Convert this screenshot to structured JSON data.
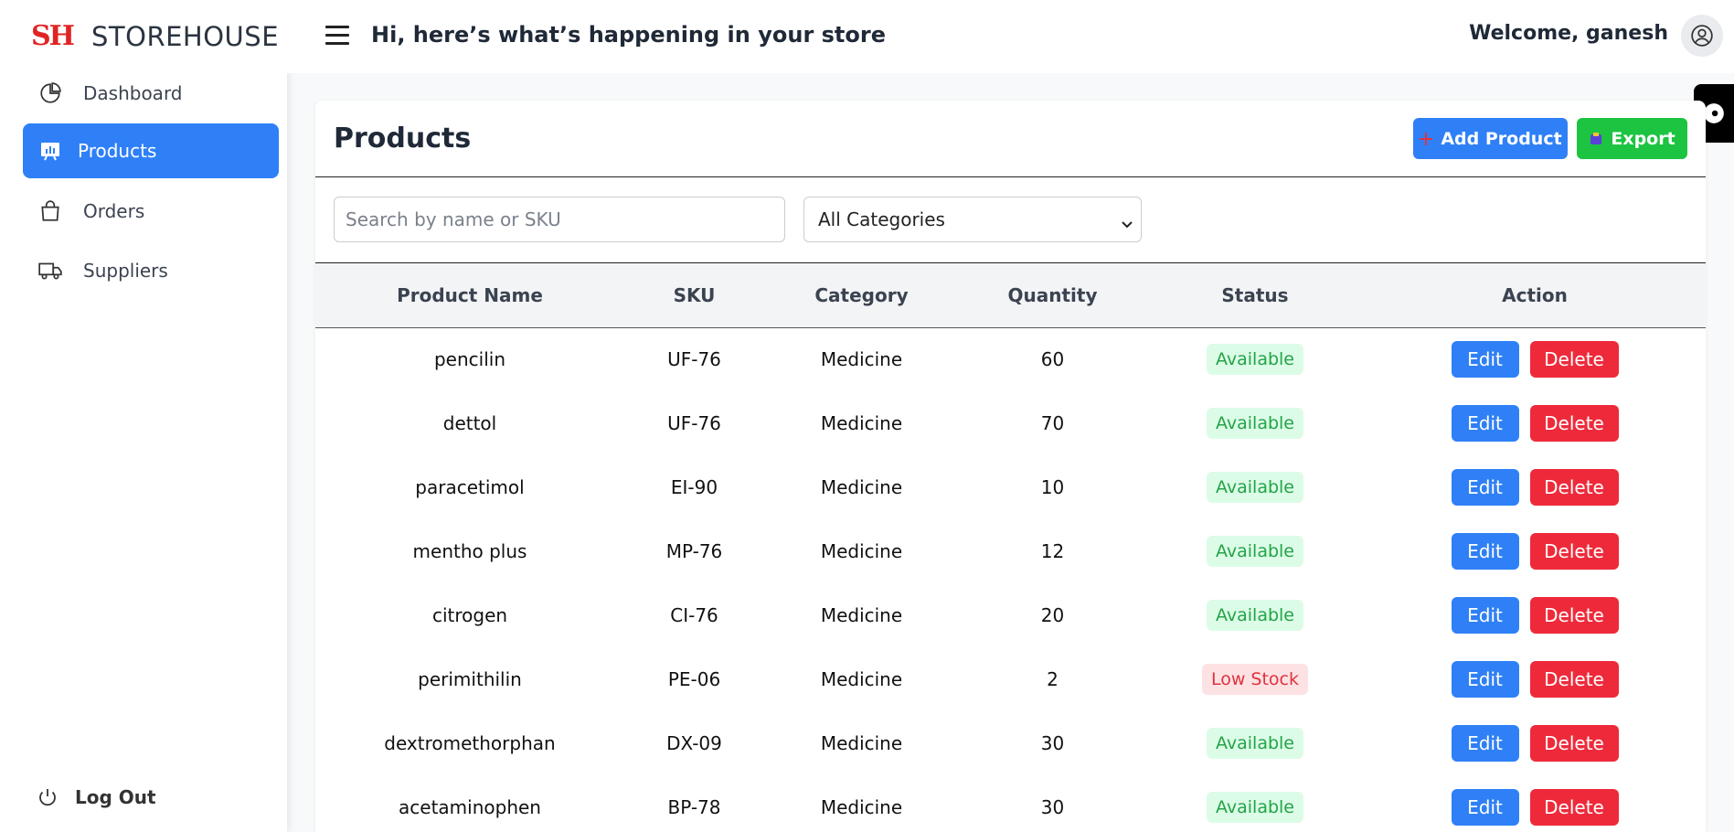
{
  "brand": {
    "logo_text": "SH",
    "name": "STOREHOUSE"
  },
  "nav": [
    {
      "label": "Dashboard",
      "icon": "pie-chart-icon"
    },
    {
      "label": "Products",
      "icon": "products-chart-icon",
      "active": true
    },
    {
      "label": "Orders",
      "icon": "shopping-bag-icon"
    },
    {
      "label": "Suppliers",
      "icon": "truck-icon"
    }
  ],
  "logout_label": "Log Out",
  "header": {
    "greeting": "Hi, here’s what’s happening in your store",
    "welcome": "Welcome, ganesh"
  },
  "page": {
    "title": "Products",
    "add_label": "Add Product",
    "export_label": "Export",
    "search_placeholder": "Search by name or SKU",
    "category_selected": "All Categories"
  },
  "table": {
    "columns": [
      "Product Name",
      "SKU",
      "Category",
      "Quantity",
      "Status",
      "Action"
    ],
    "edit_label": "Edit",
    "delete_label": "Delete",
    "rows": [
      {
        "name": "pencilin",
        "sku": "UF-76",
        "category": "Medicine",
        "quantity": "60",
        "status": "Available"
      },
      {
        "name": "dettol",
        "sku": "UF-76",
        "category": "Medicine",
        "quantity": "70",
        "status": "Available"
      },
      {
        "name": "paracetimol",
        "sku": "EI-90",
        "category": "Medicine",
        "quantity": "10",
        "status": "Available"
      },
      {
        "name": "mentho plus",
        "sku": "MP-76",
        "category": "Medicine",
        "quantity": "12",
        "status": "Available"
      },
      {
        "name": "citrogen",
        "sku": "CI-76",
        "category": "Medicine",
        "quantity": "20",
        "status": "Available"
      },
      {
        "name": "perimithilin",
        "sku": "PE-06",
        "category": "Medicine",
        "quantity": "2",
        "status": "Low Stock"
      },
      {
        "name": "dextromethorphan",
        "sku": "DX-09",
        "category": "Medicine",
        "quantity": "30",
        "status": "Available"
      },
      {
        "name": "acetaminophen",
        "sku": "BP-78",
        "category": "Medicine",
        "quantity": "30",
        "status": "Available"
      }
    ]
  },
  "colors": {
    "primary": "#2f80f7",
    "success": "#1cc441",
    "danger": "#ee2a3a",
    "brand_red": "#e02424"
  }
}
